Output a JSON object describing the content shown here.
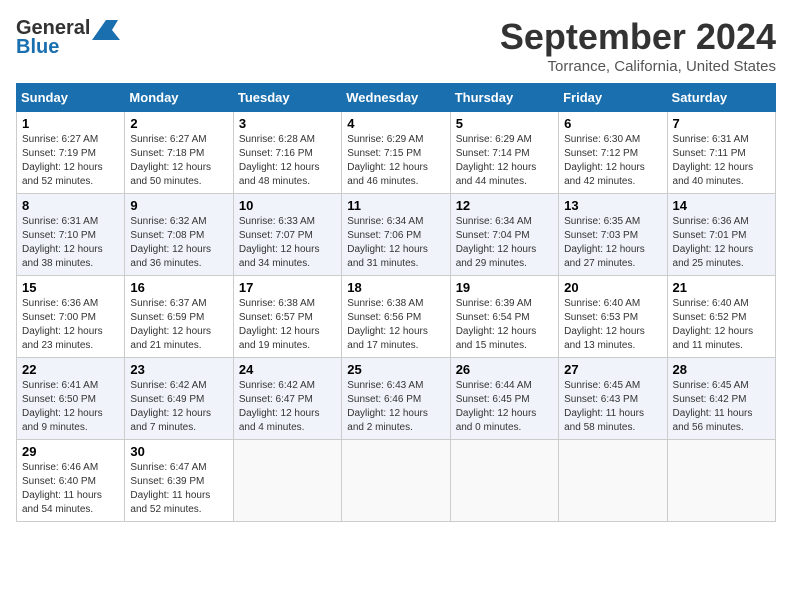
{
  "header": {
    "logo_general": "General",
    "logo_blue": "Blue",
    "month_title": "September 2024",
    "location": "Torrance, California, United States"
  },
  "calendar": {
    "days_of_week": [
      "Sunday",
      "Monday",
      "Tuesday",
      "Wednesday",
      "Thursday",
      "Friday",
      "Saturday"
    ],
    "weeks": [
      [
        null,
        {
          "day": "2",
          "sunrise": "6:27 AM",
          "sunset": "7:18 PM",
          "daylight": "12 hours and 50 minutes."
        },
        {
          "day": "3",
          "sunrise": "6:28 AM",
          "sunset": "7:16 PM",
          "daylight": "12 hours and 48 minutes."
        },
        {
          "day": "4",
          "sunrise": "6:29 AM",
          "sunset": "7:15 PM",
          "daylight": "12 hours and 46 minutes."
        },
        {
          "day": "5",
          "sunrise": "6:29 AM",
          "sunset": "7:14 PM",
          "daylight": "12 hours and 44 minutes."
        },
        {
          "day": "6",
          "sunrise": "6:30 AM",
          "sunset": "7:12 PM",
          "daylight": "12 hours and 42 minutes."
        },
        {
          "day": "7",
          "sunrise": "6:31 AM",
          "sunset": "7:11 PM",
          "daylight": "12 hours and 40 minutes."
        }
      ],
      [
        {
          "day": "1",
          "sunrise": "6:27 AM",
          "sunset": "7:19 PM",
          "daylight": "12 hours and 52 minutes."
        },
        {
          "day": "9",
          "sunrise": "6:32 AM",
          "sunset": "7:08 PM",
          "daylight": "12 hours and 36 minutes."
        },
        {
          "day": "10",
          "sunrise": "6:33 AM",
          "sunset": "7:07 PM",
          "daylight": "12 hours and 34 minutes."
        },
        {
          "day": "11",
          "sunrise": "6:34 AM",
          "sunset": "7:06 PM",
          "daylight": "12 hours and 31 minutes."
        },
        {
          "day": "12",
          "sunrise": "6:34 AM",
          "sunset": "7:04 PM",
          "daylight": "12 hours and 29 minutes."
        },
        {
          "day": "13",
          "sunrise": "6:35 AM",
          "sunset": "7:03 PM",
          "daylight": "12 hours and 27 minutes."
        },
        {
          "day": "14",
          "sunrise": "6:36 AM",
          "sunset": "7:01 PM",
          "daylight": "12 hours and 25 minutes."
        }
      ],
      [
        {
          "day": "8",
          "sunrise": "6:31 AM",
          "sunset": "7:10 PM",
          "daylight": "12 hours and 38 minutes."
        },
        {
          "day": "16",
          "sunrise": "6:37 AM",
          "sunset": "6:59 PM",
          "daylight": "12 hours and 21 minutes."
        },
        {
          "day": "17",
          "sunrise": "6:38 AM",
          "sunset": "6:57 PM",
          "daylight": "12 hours and 19 minutes."
        },
        {
          "day": "18",
          "sunrise": "6:38 AM",
          "sunset": "6:56 PM",
          "daylight": "12 hours and 17 minutes."
        },
        {
          "day": "19",
          "sunrise": "6:39 AM",
          "sunset": "6:54 PM",
          "daylight": "12 hours and 15 minutes."
        },
        {
          "day": "20",
          "sunrise": "6:40 AM",
          "sunset": "6:53 PM",
          "daylight": "12 hours and 13 minutes."
        },
        {
          "day": "21",
          "sunrise": "6:40 AM",
          "sunset": "6:52 PM",
          "daylight": "12 hours and 11 minutes."
        }
      ],
      [
        {
          "day": "15",
          "sunrise": "6:36 AM",
          "sunset": "7:00 PM",
          "daylight": "12 hours and 23 minutes."
        },
        {
          "day": "23",
          "sunrise": "6:42 AM",
          "sunset": "6:49 PM",
          "daylight": "12 hours and 7 minutes."
        },
        {
          "day": "24",
          "sunrise": "6:42 AM",
          "sunset": "6:47 PM",
          "daylight": "12 hours and 4 minutes."
        },
        {
          "day": "25",
          "sunrise": "6:43 AM",
          "sunset": "6:46 PM",
          "daylight": "12 hours and 2 minutes."
        },
        {
          "day": "26",
          "sunrise": "6:44 AM",
          "sunset": "6:45 PM",
          "daylight": "12 hours and 0 minutes."
        },
        {
          "day": "27",
          "sunrise": "6:45 AM",
          "sunset": "6:43 PM",
          "daylight": "11 hours and 58 minutes."
        },
        {
          "day": "28",
          "sunrise": "6:45 AM",
          "sunset": "6:42 PM",
          "daylight": "11 hours and 56 minutes."
        }
      ],
      [
        {
          "day": "22",
          "sunrise": "6:41 AM",
          "sunset": "6:50 PM",
          "daylight": "12 hours and 9 minutes."
        },
        {
          "day": "30",
          "sunrise": "6:47 AM",
          "sunset": "6:39 PM",
          "daylight": "11 hours and 52 minutes."
        },
        null,
        null,
        null,
        null,
        null
      ],
      [
        {
          "day": "29",
          "sunrise": "6:46 AM",
          "sunset": "6:40 PM",
          "daylight": "11 hours and 54 minutes."
        },
        null,
        null,
        null,
        null,
        null,
        null
      ]
    ]
  }
}
